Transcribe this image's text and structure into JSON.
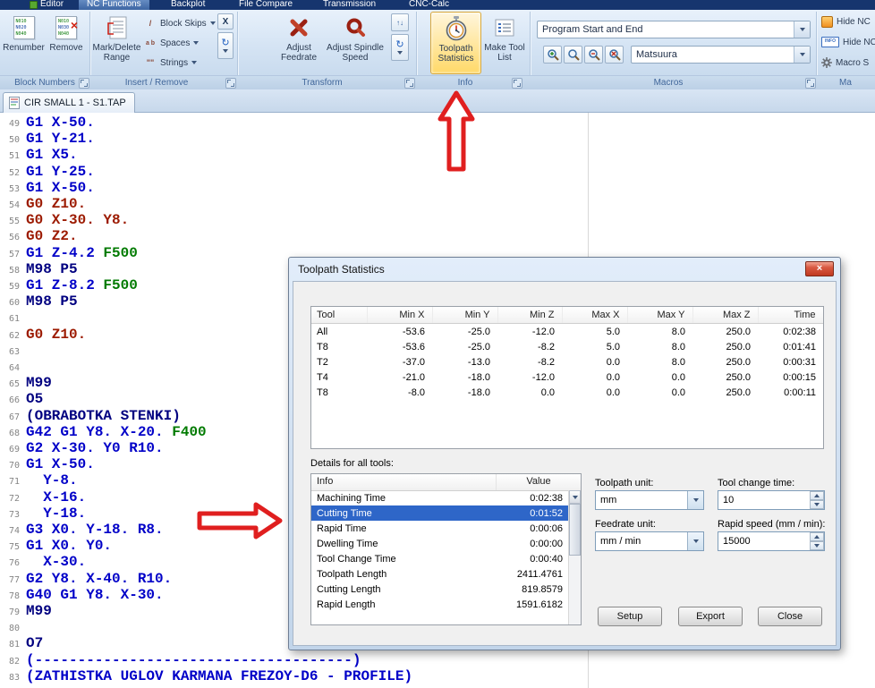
{
  "palette": {
    "code_blue": "#0000C8",
    "code_red": "#9C1A00",
    "code_green": "#007A00",
    "code_navy": "#000080",
    "selection_blue": "#2E66C8",
    "ribbon_hot_orange": "#FFD968",
    "arrow_red": "#E01F1F"
  },
  "icons": {
    "refresh_glyph": "↻",
    "updown_glyph": "↑↓",
    "block_skips_glyph": "/",
    "spaces_glyph": "a b",
    "strings_glyph": "\"\"",
    "close_glyph": "×",
    "x_button_glyph": "X"
  },
  "ribbon": {
    "tabs": [
      {
        "label": "Editor",
        "active": false
      },
      {
        "label": "NC Functions",
        "active": true
      },
      {
        "label": "Backplot",
        "active": false
      },
      {
        "label": "File Compare",
        "active": false
      },
      {
        "label": "Transmission",
        "active": false
      },
      {
        "label": "CNC-Calc",
        "active": false
      }
    ],
    "block_numbers": {
      "group_label": "Block Numbers",
      "renumber_label": "Renumber",
      "remove_label": "Remove",
      "renumber_icon_lines": [
        "N010",
        "N020",
        "N040"
      ],
      "remove_icon_lines": [
        "N010",
        "N030",
        "N040"
      ]
    },
    "insert_remove": {
      "group_label": "Insert / Remove",
      "mark_delete_label": "Mark/Delete Range",
      "menu_items": [
        {
          "label": "Block Skips"
        },
        {
          "label": "Spaces"
        },
        {
          "label": "Strings"
        }
      ]
    },
    "transform": {
      "group_label": "Transform",
      "adjust_feedrate_label": "Adjust Feedrate",
      "adjust_spindle_label": "Adjust Spindle Speed"
    },
    "info": {
      "group_label": "Info",
      "toolpath_statistics_label": "Toolpath Statistics",
      "make_tool_list_label": "Make Tool List"
    },
    "macros": {
      "group_label": "Macros",
      "combo_top_value": "Program Start and End",
      "combo_bottom_value": "Matsuura"
    },
    "right_group": {
      "group_label": "Ma",
      "items": [
        "Hide NC",
        "Hide NC",
        "Macro S"
      ],
      "info_badge_text": "INFO"
    }
  },
  "file_tab": {
    "label": "CIR SMALL 1 - S1.TAP"
  },
  "editor": {
    "lines": [
      {
        "n": 49,
        "segs": [
          {
            "t": "G1 X-50.",
            "c": "blue"
          }
        ]
      },
      {
        "n": 50,
        "segs": [
          {
            "t": "G1 Y-21.",
            "c": "blue"
          }
        ]
      },
      {
        "n": 51,
        "segs": [
          {
            "t": "G1 X5.",
            "c": "blue"
          }
        ]
      },
      {
        "n": 52,
        "segs": [
          {
            "t": "G1 Y-25.",
            "c": "blue"
          }
        ]
      },
      {
        "n": 53,
        "segs": [
          {
            "t": "G1 X-50.",
            "c": "blue"
          }
        ]
      },
      {
        "n": 54,
        "segs": [
          {
            "t": "G0 Z10.",
            "c": "red"
          }
        ]
      },
      {
        "n": 55,
        "segs": [
          {
            "t": "G0 X-30. Y8.",
            "c": "red"
          }
        ]
      },
      {
        "n": 56,
        "segs": [
          {
            "t": "G0 Z2.",
            "c": "red"
          }
        ]
      },
      {
        "n": 57,
        "segs": [
          {
            "t": "G1 Z-4.2 ",
            "c": "blue"
          },
          {
            "t": "F500",
            "c": "green"
          }
        ]
      },
      {
        "n": 58,
        "segs": [
          {
            "t": "M98 P5",
            "c": "navy"
          }
        ]
      },
      {
        "n": 59,
        "segs": [
          {
            "t": "G1 Z-8.2 ",
            "c": "blue"
          },
          {
            "t": "F500",
            "c": "green"
          }
        ]
      },
      {
        "n": 60,
        "segs": [
          {
            "t": "M98 P5",
            "c": "navy"
          }
        ]
      },
      {
        "n": 61,
        "segs": []
      },
      {
        "n": 62,
        "segs": [
          {
            "t": "G0 Z10.",
            "c": "red"
          }
        ]
      },
      {
        "n": 63,
        "segs": []
      },
      {
        "n": 64,
        "segs": []
      },
      {
        "n": 65,
        "segs": [
          {
            "t": "M99",
            "c": "navy"
          }
        ]
      },
      {
        "n": 66,
        "segs": [
          {
            "t": "O5",
            "c": "navy"
          }
        ]
      },
      {
        "n": 67,
        "segs": [
          {
            "t": "(OBRABOTKA STENKI)",
            "c": "navy"
          }
        ]
      },
      {
        "n": 68,
        "segs": [
          {
            "t": "G42 G1 Y8. X-20. ",
            "c": "blue"
          },
          {
            "t": "F400",
            "c": "green"
          }
        ]
      },
      {
        "n": 69,
        "segs": [
          {
            "t": "G2 X-30. Y0 R10.",
            "c": "blue"
          }
        ]
      },
      {
        "n": 70,
        "segs": [
          {
            "t": "G1 X-50.",
            "c": "blue"
          }
        ]
      },
      {
        "n": 71,
        "segs": [
          {
            "t": "  Y-8.",
            "c": "blue"
          }
        ]
      },
      {
        "n": 72,
        "segs": [
          {
            "t": "  X-16.",
            "c": "blue"
          }
        ]
      },
      {
        "n": 73,
        "segs": [
          {
            "t": "  Y-18.",
            "c": "blue"
          }
        ]
      },
      {
        "n": 74,
        "segs": [
          {
            "t": "G3 X0. Y-18. R8.",
            "c": "blue"
          }
        ]
      },
      {
        "n": 75,
        "segs": [
          {
            "t": "G1 X0. Y0.",
            "c": "blue"
          }
        ]
      },
      {
        "n": 76,
        "segs": [
          {
            "t": "  X-30.",
            "c": "blue"
          }
        ]
      },
      {
        "n": 77,
        "segs": [
          {
            "t": "G2 Y8. X-40. R10.",
            "c": "blue"
          }
        ]
      },
      {
        "n": 78,
        "segs": [
          {
            "t": "G40 G1 Y8. X-30.",
            "c": "blue"
          }
        ]
      },
      {
        "n": 79,
        "segs": [
          {
            "t": "M99",
            "c": "navy"
          }
        ]
      },
      {
        "n": 80,
        "segs": []
      },
      {
        "n": 81,
        "segs": [
          {
            "t": "O7",
            "c": "navy"
          }
        ]
      },
      {
        "n": 82,
        "segs": [
          {
            "t": "(-------------------------------------)",
            "c": "blue"
          }
        ]
      },
      {
        "n": 83,
        "segs": [
          {
            "t": "(ZATHISTKA UGLOV KARMANA FREZOY-D6 - PROFILE)",
            "c": "blue"
          }
        ]
      }
    ]
  },
  "dialog": {
    "title": "Toolpath Statistics",
    "stats_table": {
      "headers": [
        "Tool",
        "Min X",
        "Min Y",
        "Min Z",
        "Max X",
        "Max Y",
        "Max Z",
        "Time"
      ],
      "rows": [
        [
          "All",
          "-53.6",
          "-25.0",
          "-12.0",
          "5.0",
          "8.0",
          "250.0",
          "0:02:38"
        ],
        [
          "T8",
          "-53.6",
          "-25.0",
          "-8.2",
          "5.0",
          "8.0",
          "250.0",
          "0:01:41"
        ],
        [
          "T2",
          "-37.0",
          "-13.0",
          "-8.2",
          "0.0",
          "8.0",
          "250.0",
          "0:00:31"
        ],
        [
          "T4",
          "-21.0",
          "-18.0",
          "-12.0",
          "0.0",
          "0.0",
          "250.0",
          "0:00:15"
        ],
        [
          "T8",
          "-8.0",
          "-18.0",
          "0.0",
          "0.0",
          "0.0",
          "250.0",
          "0:00:11"
        ]
      ]
    },
    "details_label": "Details for all tools:",
    "details_table": {
      "headers": [
        "Info",
        "Value"
      ],
      "rows": [
        {
          "info": "Machining Time",
          "value": "0:02:38",
          "selected": false
        },
        {
          "info": "Cutting Time",
          "value": "0:01:52",
          "selected": true
        },
        {
          "info": "Rapid Time",
          "value": "0:00:06",
          "selected": false
        },
        {
          "info": "Dwelling Time",
          "value": "0:00:00",
          "selected": false
        },
        {
          "info": "Tool Change Time",
          "value": "0:00:40",
          "selected": false
        },
        {
          "info": "Toolpath Length",
          "value": "2411.4761",
          "selected": false
        },
        {
          "info": "Cutting Length",
          "value": "819.8579",
          "selected": false
        },
        {
          "info": "Rapid Length",
          "value": "1591.6182",
          "selected": false
        }
      ]
    },
    "controls": {
      "toolpath_unit_label": "Toolpath unit:",
      "toolpath_unit_value": "mm",
      "tool_change_time_label": "Tool change time:",
      "tool_change_time_value": "10",
      "feedrate_unit_label": "Feedrate unit:",
      "feedrate_unit_value": "mm / min",
      "rapid_speed_label": "Rapid speed (mm / min):",
      "rapid_speed_value": "15000"
    },
    "buttons": {
      "setup": "Setup",
      "export": "Export",
      "close": "Close"
    }
  }
}
